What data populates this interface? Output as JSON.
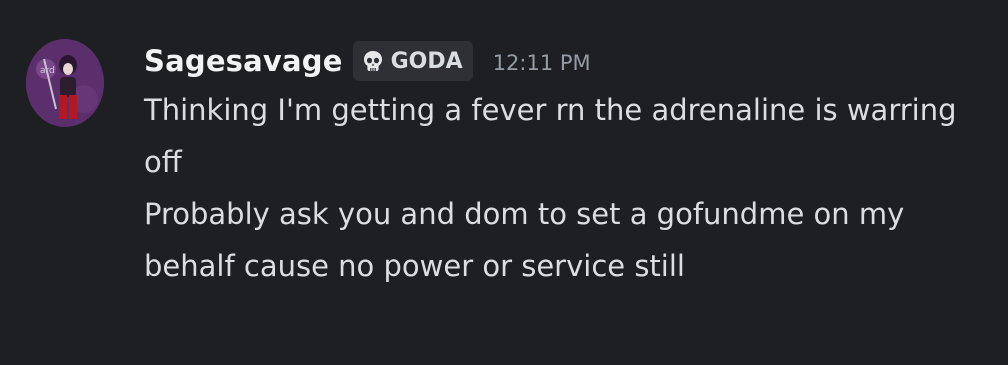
{
  "author": {
    "username": "Sagesavage",
    "tag_icon": "skull-icon",
    "tag_label": "GODA",
    "timestamp": "12:11 PM"
  },
  "messages": [
    {
      "text": "Thinking I'm getting a fever rn the adrenaline is warring off"
    },
    {
      "text": "Probably ask you and dom to set a gofundme on my behalf cause no power or service still"
    }
  ],
  "colors": {
    "background": "#1e1f22",
    "username": "#f2f3f5",
    "body_text": "#dbdee1",
    "timestamp": "#949ba4",
    "tag_background": "#2e3035"
  }
}
